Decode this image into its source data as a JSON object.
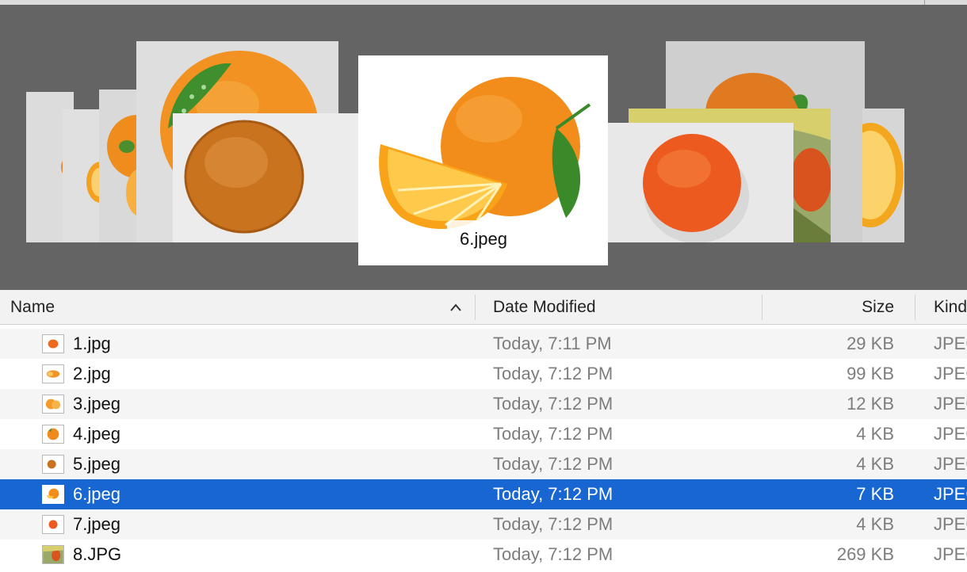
{
  "coverflow": {
    "selected_caption": "6.jpeg"
  },
  "columns": {
    "name": "Name",
    "date": "Date Modified",
    "size": "Size",
    "kind": "Kind",
    "sort_indicator": "chevron-up-icon"
  },
  "files": [
    {
      "name": "1.jpg",
      "date": "Today, 7:11 PM",
      "size": "29 KB",
      "kind": "JPEG image"
    },
    {
      "name": "2.jpg",
      "date": "Today, 7:12 PM",
      "size": "99 KB",
      "kind": "JPEG image"
    },
    {
      "name": "3.jpeg",
      "date": "Today, 7:12 PM",
      "size": "12 KB",
      "kind": "JPEG image"
    },
    {
      "name": "4.jpeg",
      "date": "Today, 7:12 PM",
      "size": "4 KB",
      "kind": "JPEG image"
    },
    {
      "name": "5.jpeg",
      "date": "Today, 7:12 PM",
      "size": "4 KB",
      "kind": "JPEG image"
    },
    {
      "name": "6.jpeg",
      "date": "Today, 7:12 PM",
      "size": "7 KB",
      "kind": "JPEG image",
      "selected": true
    },
    {
      "name": "7.jpeg",
      "date": "Today, 7:12 PM",
      "size": "4 KB",
      "kind": "JPEG image"
    },
    {
      "name": "8.JPG",
      "date": "Today, 7:12 PM",
      "size": "269 KB",
      "kind": "JPEG image"
    }
  ],
  "colors": {
    "coverflow_bg": "#646464",
    "selection": "#1766d1",
    "orange": "#f28c1a",
    "leaf": "#3f8f2e"
  }
}
